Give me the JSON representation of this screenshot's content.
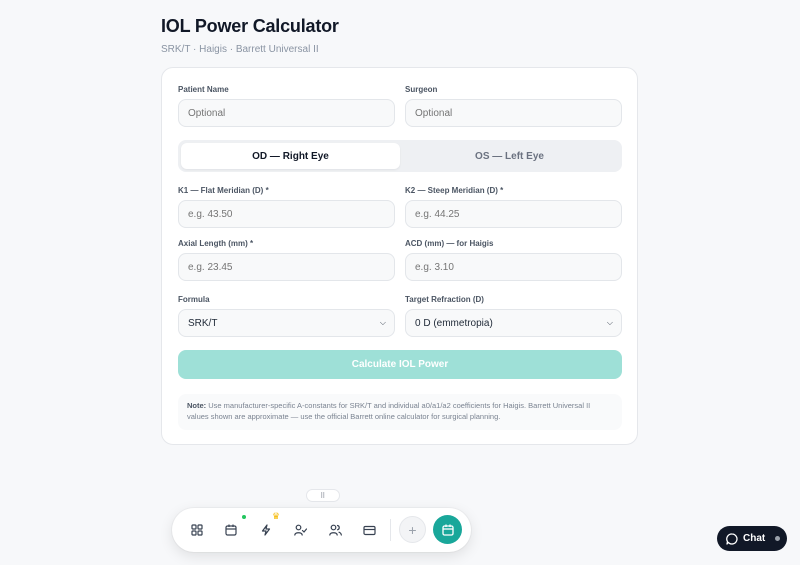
{
  "header": {
    "title": "IOL Power Calculator",
    "subtitle": "SRK/T · Haigis · Barrett Universal II"
  },
  "form": {
    "patient_name": {
      "label": "Patient Name",
      "placeholder": "Optional"
    },
    "surgeon": {
      "label": "Surgeon",
      "placeholder": "Optional"
    },
    "eye_toggle": {
      "options": [
        "OD — Right Eye",
        "OS — Left Eye"
      ],
      "selected": "OD — Right Eye"
    },
    "k1": {
      "label": "K1 — Flat Meridian (D) *",
      "placeholder": "e.g. 43.50"
    },
    "k2": {
      "label": "K2 — Steep Meridian (D) *",
      "placeholder": "e.g. 44.25"
    },
    "axial_length": {
      "label": "Axial Length (mm) *",
      "placeholder": "e.g. 23.45"
    },
    "acd": {
      "label": "ACD (mm) — for Haigis",
      "placeholder": "e.g. 3.10"
    },
    "formula": {
      "label": "Formula",
      "value": "SRK/T"
    },
    "target_refraction": {
      "label": "Target Refraction (D)",
      "value": "0 D (emmetropia)"
    },
    "calculate_label": "Calculate IOL Power",
    "note_bold": "Note:",
    "note_text": "Use manufacturer-specific A-constants for SRK/T and individual a0/a1/a2 coefficients for Haigis. Barrett Universal II values shown are approximate — use the official Barrett online calculator for surgical planning."
  },
  "dock": {
    "handle": "⠿",
    "items": [
      "grid-icon",
      "calendar-icon",
      "bolt-icon",
      "user-check-icon",
      "users-icon",
      "card-icon"
    ],
    "plus": "+",
    "active": "calendar-icon"
  },
  "chat": {
    "label": "Chat"
  },
  "colors": {
    "accent": "#19a79a",
    "button_disabled": "#9ee0d7",
    "chat_bg": "#111827"
  }
}
